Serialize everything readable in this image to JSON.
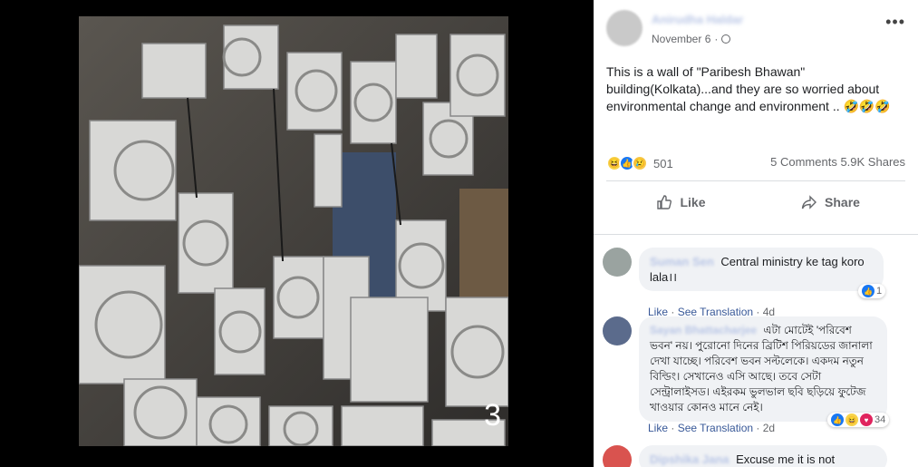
{
  "photo": {
    "number": "3",
    "description_icon": "air-conditioner-wall-photo"
  },
  "post": {
    "author": "Anirudha Haldar",
    "date": "November 6",
    "privacy_icon": "globe-icon",
    "more_icon": "more-icon",
    "caption": "This is a wall of \"Paribesh Bhawan\" building(Kolkata)...and they are so worried about environmental change and environment .. 🤣🤣🤣",
    "reaction_count": "501",
    "comments_count": "5 Comments",
    "shares_count": "5.9K Shares",
    "like_label": "Like",
    "share_label": "Share"
  },
  "comments": [
    {
      "name": "Suman Sen",
      "text": "Central ministry ke tag koro lala।।",
      "like_label": "Like",
      "translate_label": "See Translation",
      "age": "4d",
      "reaction_count": "1",
      "avatar_color": "#9aa3a0"
    },
    {
      "name": "Sayan Bhattacharjee",
      "text": "এটা মোটেই 'পরিবেশ ভবন' নয়। পুরোনো দিনের ব্রিটিশ পিরিয়ডের জানালা দেখা যাচ্ছে। পরিবেশ ভবন সল্টলেকে। একদম নতুন বিল্ডিং। সেখানেও এসি আছে। তবে সেটা সেন্ট্রালাইসড। এইরকম ভুলভাল ছবি ছড়িয়ে ফুটেজ খাওয়ার কোনও মানে নেই।",
      "like_label": "Like",
      "translate_label": "See Translation",
      "age": "2d",
      "reaction_count": "34",
      "avatar_color": "#5b6b8c"
    },
    {
      "name": "Dipshika Jana",
      "text": "Excuse me it is not",
      "avatar_color": "#d9534f"
    }
  ]
}
